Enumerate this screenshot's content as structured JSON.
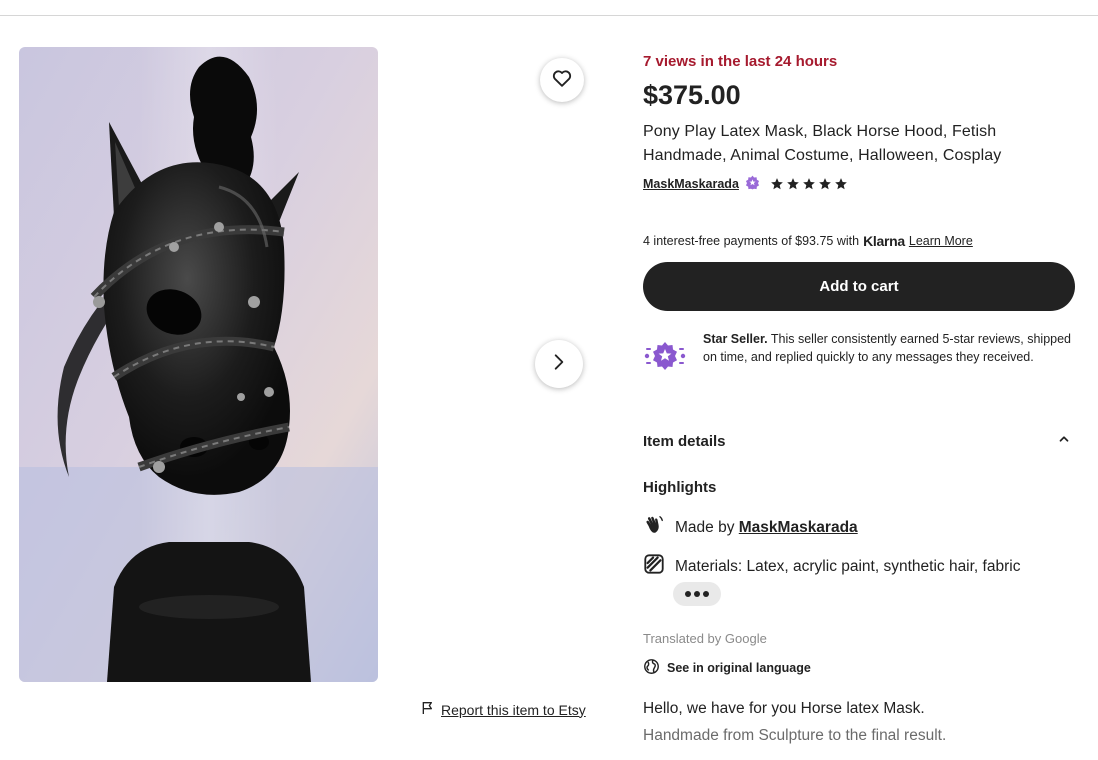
{
  "listing": {
    "views_notice": "7 views in the last 24 hours",
    "price": "$375.00",
    "title": "Pony Play Latex Mask, Black Horse Hood, Fetish Handmade, Animal Costume, Halloween, Cosplay",
    "shop_name": "MaskMaskarada",
    "rating_stars": 5
  },
  "gallery": {
    "image_alt": "Black latex horse head mask with braided straps and metal studs on a mannequin head",
    "favorite_icon": "heart-icon",
    "next_icon": "chevron-right-icon",
    "report_label": "Report this item to Etsy"
  },
  "klarna": {
    "text": "4 interest-free payments of $93.75 with",
    "logo": "Klarna",
    "learn_more": "Learn More"
  },
  "cart": {
    "add_label": "Add to cart"
  },
  "star_seller": {
    "title": "Star Seller.",
    "text": "This seller consistently earned 5-star reviews, shipped on time, and replied quickly to any messages they received."
  },
  "item_details": {
    "heading": "Item details",
    "highlights_heading": "Highlights",
    "made_by_prefix": "Made by",
    "made_by_shop": "MaskMaskarada",
    "materials": "Materials: Latex, acrylic paint, synthetic hair, fabric"
  },
  "translation": {
    "notice": "Translated by Google",
    "see_original": "See in original language"
  },
  "description": {
    "line1": "Hello, we have for you Horse latex Mask.",
    "line2": "Handmade from Sculpture to the final result."
  },
  "colors": {
    "views_accent": "#a61a2e",
    "button_dark": "#222222",
    "star_seller_purple": "#7f4cc8",
    "muted_text": "#8a8a8a"
  }
}
